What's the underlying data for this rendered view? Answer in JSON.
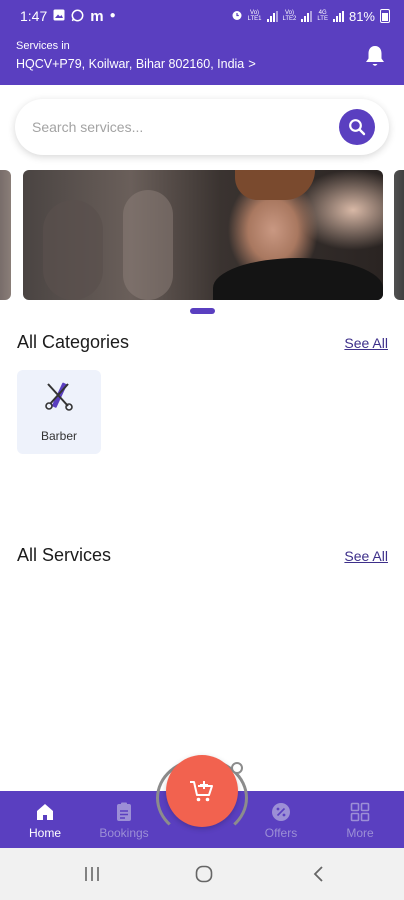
{
  "status_bar": {
    "time": "1:47",
    "left_icons": [
      "image-icon",
      "whatsapp-icon",
      "m-app-icon",
      "dot-icon"
    ],
    "right_icons": [
      "alarm-icon",
      "volte-signal-icon",
      "volte-signal-icon",
      "4g-signal-icon",
      "signal-icon",
      "battery-icon"
    ],
    "signal_tags": [
      "Vo)\nLTE1",
      "Vo)\nLTE2",
      "4G\nLTE"
    ],
    "battery": "81%"
  },
  "header": {
    "location_label": "Services in",
    "location_value": "HQCV+P79, Koilwar, Bihar 802160, India",
    "location_chevron": ">",
    "bell_icon": "bell-icon"
  },
  "search": {
    "placeholder": "Search services...",
    "value": "",
    "icon": "search-icon"
  },
  "banner": {
    "slides_visible": 3,
    "active_index": 0
  },
  "categories": {
    "title": "All Categories",
    "see_all": "See All",
    "items": [
      {
        "label": "Barber",
        "icon": "scissors-comb-icon"
      }
    ]
  },
  "services": {
    "title": "All Services",
    "see_all": "See All"
  },
  "bottom_nav": {
    "items": [
      {
        "label": "Home",
        "icon": "home-icon",
        "active": true
      },
      {
        "label": "Bookings",
        "icon": "clipboard-icon",
        "active": false
      },
      {
        "label": "Offers",
        "icon": "discount-badge-icon",
        "active": false
      },
      {
        "label": "More",
        "icon": "grid-icon",
        "active": false
      }
    ],
    "fab_icon": "cart-plus-icon"
  },
  "system_nav": [
    "recents-icon",
    "home-circle-icon",
    "back-icon"
  ],
  "colors": {
    "primary": "#5a3fc0",
    "fab": "#f2624f",
    "category_bg": "#eef2fb",
    "link": "#3d2f8a"
  }
}
